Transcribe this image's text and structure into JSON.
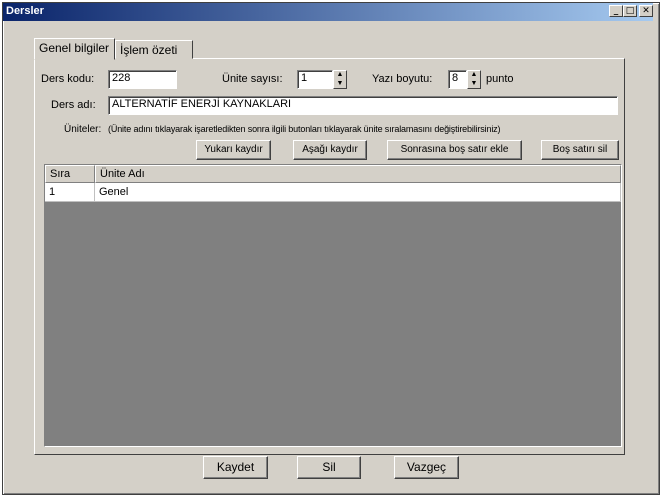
{
  "window": {
    "title": "Dersler",
    "minimize": "_",
    "maximize": "□",
    "close": "✕"
  },
  "tabs": [
    {
      "label": "Genel bilgiler"
    },
    {
      "label": "İşlem özeti"
    }
  ],
  "form": {
    "ders_kodu_label": "Ders kodu:",
    "ders_kodu_value": "228",
    "unite_sayisi_label": "Ünite sayısı:",
    "unite_sayisi_value": "1",
    "yazi_boyutu_label": "Yazı boyutu:",
    "yazi_boyutu_value": "8",
    "punto_label": "punto",
    "ders_adi_label": "Ders adı:",
    "ders_adi_value": "ALTERNATİF ENERJİ KAYNAKLARI",
    "uniteler_label": "Üniteler:",
    "uniteler_hint": "(Ünite adını tıklayarak işaretledikten sonra ilgili butonları tıklayarak ünite sıralamasını değiştirebilirsiniz)"
  },
  "unit_buttons": {
    "up": "Yukarı kaydır",
    "down": "Aşağı kaydır",
    "insert_blank": "Sonrasına boş satır ekle",
    "delete_blank": "Boş satırı sil"
  },
  "grid": {
    "columns": [
      "Sıra",
      "Ünite Adı"
    ],
    "rows": [
      [
        "1",
        "Genel"
      ]
    ]
  },
  "footer": {
    "save": "Kaydet",
    "delete": "Sil",
    "cancel": "Vazgeç"
  }
}
